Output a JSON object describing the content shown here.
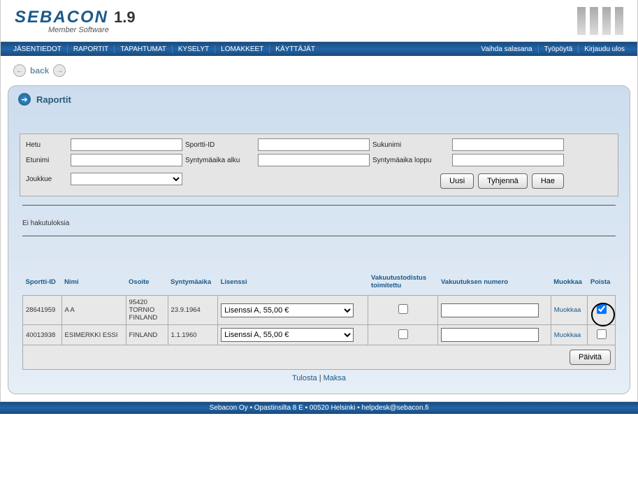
{
  "brand": {
    "name": "SEBACON",
    "version": "1.9",
    "subtitle": "Member Software"
  },
  "nav": {
    "left": [
      "JÄSENTIEDOT",
      "RAPORTIT",
      "TAPAHTUMAT",
      "KYSELYT",
      "LOMAKKEET",
      "KÄYTTÄJÄT"
    ],
    "right": [
      "Vaihda salasana",
      "Työpöytä",
      "Kirjaudu ulos"
    ]
  },
  "back_label": "back",
  "panel": {
    "title": "Raportit"
  },
  "filters": {
    "labels": {
      "hetu": "Hetu",
      "sportti_id": "Sportti-ID",
      "sukunimi": "Sukunimi",
      "etunimi": "Etunimi",
      "synt_alku": "Syntymäaika alku",
      "synt_loppu": "Syntymäaika loppu",
      "joukkue": "Joukkue"
    },
    "values": {
      "hetu": "",
      "sportti_id": "",
      "sukunimi": "",
      "etunimi": "",
      "synt_alku": "",
      "synt_loppu": ""
    },
    "buttons": {
      "uusi": "Uusi",
      "tyhjenna": "Tyhjennä",
      "hae": "Hae"
    }
  },
  "empty_text": "Ei hakutuloksia",
  "table": {
    "headers": {
      "sportti_id": "Sportti-ID",
      "nimi": "Nimi",
      "osoite": "Osoite",
      "syntyma": "Syntymäaika",
      "lisenssi": "Lisenssi",
      "vakuutus_toimitettu": "Vakuutustodistus toimitettu",
      "vakuutus_numero": "Vakuutuksen numero",
      "muokkaa": "Muokkaa",
      "poista": "Poista"
    },
    "rows": [
      {
        "sportti_id": "28641959",
        "nimi": "A A",
        "osoite": "95420 TORNIO FINLAND",
        "syntyma": "23.9.1964",
        "lisenssi": "Lisenssi A, 55,00 €",
        "vakuutus_toimitettu": false,
        "vakuutus_numero": "",
        "poista": true
      },
      {
        "sportti_id": "40013938",
        "nimi": "ESIMERKKI ESSI",
        "osoite": "FINLAND",
        "syntyma": "1.1.1960",
        "lisenssi": "Lisenssi A, 55,00 €",
        "vakuutus_toimitettu": false,
        "vakuutus_numero": "",
        "poista": false
      }
    ],
    "edit_label": "Muokkaa",
    "update_label": "Päivitä"
  },
  "links": {
    "tulosta": "Tulosta",
    "maksa": "Maksa"
  },
  "footer": {
    "company": "Sebacon Oy",
    "addr": "Opastinsilta 8 E",
    "zip": "00520 Helsinki",
    "email": "helpdesk@sebacon.fi"
  }
}
